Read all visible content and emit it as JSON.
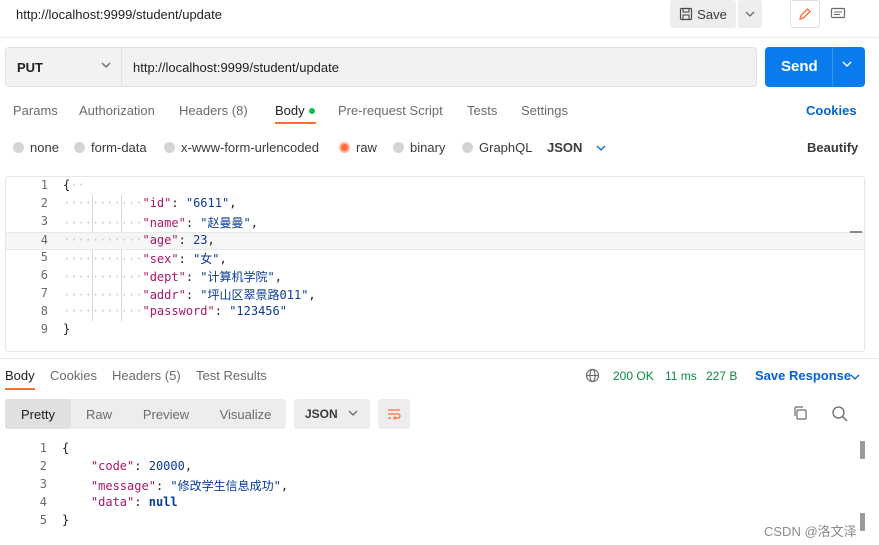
{
  "header": {
    "title": "http://localhost:9999/student/update",
    "save_label": "Save"
  },
  "request": {
    "method": "PUT",
    "url": "http://localhost:9999/student/update",
    "send_label": "Send"
  },
  "request_tabs": {
    "params": "Params",
    "authorization": "Authorization",
    "headers": "Headers",
    "headers_count": "(8)",
    "body": "Body",
    "prerequest": "Pre-request Script",
    "tests": "Tests",
    "settings": "Settings",
    "cookies": "Cookies"
  },
  "body_types": {
    "none": "none",
    "form_data": "form-data",
    "urlencoded": "x-www-form-urlencoded",
    "raw": "raw",
    "binary": "binary",
    "graphql": "GraphQL",
    "format": "JSON",
    "beautify": "Beautify"
  },
  "request_body": {
    "line_numbers": [
      "1",
      "2",
      "3",
      "4",
      "5",
      "6",
      "7",
      "8",
      "9"
    ],
    "open": "{",
    "close": "}",
    "fields": [
      {
        "key": "\"id\"",
        "value": "\"6611\"",
        "comma": ","
      },
      {
        "key": "\"name\"",
        "value": "\"赵曼曼\"",
        "comma": ","
      },
      {
        "key": "\"age\"",
        "value": "23",
        "comma": ","
      },
      {
        "key": "\"sex\"",
        "value": "\"女\"",
        "comma": ","
      },
      {
        "key": "\"dept\"",
        "value": "\"计算机学院\"",
        "comma": ","
      },
      {
        "key": "\"addr\"",
        "value": "\"坪山区翠景路011\"",
        "comma": ","
      },
      {
        "key": "\"password\"",
        "value": "\"123456\"",
        "comma": ""
      }
    ]
  },
  "response_tabs": {
    "body": "Body",
    "cookies": "Cookies",
    "headers": "Headers",
    "headers_count": "(5)",
    "test_results": "Test Results",
    "status": "200 OK",
    "time": "11 ms",
    "size": "227 B",
    "save_response": "Save Response"
  },
  "response_view": {
    "pretty": "Pretty",
    "raw": "Raw",
    "preview": "Preview",
    "visualize": "Visualize",
    "format": "JSON"
  },
  "response_body": {
    "line_numbers": [
      "1",
      "2",
      "3",
      "4",
      "5"
    ],
    "open": "{",
    "close": "}",
    "fields": [
      {
        "key": "\"code\"",
        "value": "20000",
        "comma": ","
      },
      {
        "key": "\"message\"",
        "value": "\"修改学生信息成功\"",
        "comma": ","
      },
      {
        "key": "\"data\"",
        "value": "null",
        "comma": ""
      }
    ]
  },
  "watermark": "CSDN @洛文泽",
  "colors": {
    "accent_orange": "#ff6c37",
    "send_blue": "#097bed",
    "link_blue": "#0265d2",
    "status_green": "#0a8a43",
    "json_key": "#a6196a",
    "json_value": "#0a3a96"
  }
}
